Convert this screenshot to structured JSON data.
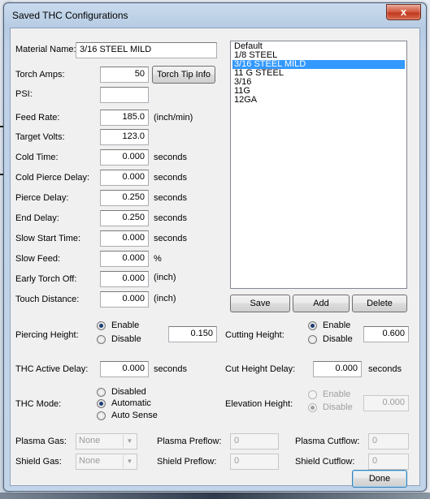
{
  "window": {
    "title": "Saved THC Configurations",
    "close_label": "x"
  },
  "fields": {
    "material_name": {
      "label": "Material Name:",
      "value": "3/16 STEEL MILD"
    },
    "torch_amps": {
      "label": "Torch Amps:",
      "value": "50"
    },
    "torch_tip_info": "Torch Tip Info",
    "psi": {
      "label": "PSI:",
      "value": ""
    },
    "feed_rate": {
      "label": "Feed Rate:",
      "value": "185.0",
      "unit": "(inch/min)"
    },
    "target_volts": {
      "label": "Target Volts:",
      "value": "123.0"
    },
    "cold_time": {
      "label": "Cold Time:",
      "value": "0.000",
      "unit": "seconds"
    },
    "cold_pierce_delay": {
      "label": "Cold Pierce Delay:",
      "value": "0.000",
      "unit": "seconds"
    },
    "pierce_delay": {
      "label": "Pierce Delay:",
      "value": "0.250",
      "unit": "seconds"
    },
    "end_delay": {
      "label": "End Delay:",
      "value": "0.250",
      "unit": "seconds"
    },
    "slow_start_time": {
      "label": "Slow Start Time:",
      "value": "0.000",
      "unit": "seconds"
    },
    "slow_feed": {
      "label": "Slow Feed:",
      "value": "0.000",
      "unit": "%"
    },
    "early_torch_off": {
      "label": "Early Torch Off:",
      "value": "0.000",
      "unit": "(inch)"
    },
    "touch_distance": {
      "label": "Touch Distance:",
      "value": "0.000",
      "unit": "(inch)"
    }
  },
  "configs": {
    "items": [
      "Default",
      "1/8 STEEL",
      "3/16 STEEL MILD",
      "11 G STEEL",
      "3/16",
      "11G",
      "12GA"
    ],
    "selected": "3/16 STEEL MILD"
  },
  "list_buttons": {
    "save": "Save",
    "add": "Add",
    "delete": "Delete"
  },
  "piercing_height": {
    "label": "Piercing Height:",
    "enable": "Enable",
    "disable": "Disable",
    "selected": "Enable",
    "value": "0.150"
  },
  "cutting_height": {
    "label": "Cutting Height:",
    "enable": "Enable",
    "disable": "Disable",
    "selected": "Enable",
    "value": "0.600"
  },
  "thc_active_delay": {
    "label": "THC Active Delay:",
    "value": "0.000",
    "unit": "seconds"
  },
  "cut_height_delay": {
    "label": "Cut Height Delay:",
    "value": "0.000",
    "unit": "seconds"
  },
  "thc_mode": {
    "label": "THC Mode:",
    "options": [
      "Disabled",
      "Automatic",
      "Auto Sense"
    ],
    "selected": "Automatic"
  },
  "elevation_height": {
    "label": "Elevation Height:",
    "enable": "Enable",
    "disable": "Disable",
    "selected": "Disable",
    "value": "0.000"
  },
  "plasma_gas": {
    "label": "Plasma Gas:",
    "value": "None"
  },
  "shield_gas": {
    "label": "Shield Gas:",
    "value": "None"
  },
  "plasma_preflow": {
    "label": "Plasma Preflow:",
    "value": "0"
  },
  "shield_preflow": {
    "label": "Shield Preflow:",
    "value": "0"
  },
  "plasma_cutflow": {
    "label": "Plasma Cutflow:",
    "value": "0"
  },
  "shield_cutflow": {
    "label": "Shield Cutflow:",
    "value": "0"
  },
  "done": "Done",
  "colors": {
    "selection": "#3399ff",
    "title_close": "#c0381c"
  }
}
